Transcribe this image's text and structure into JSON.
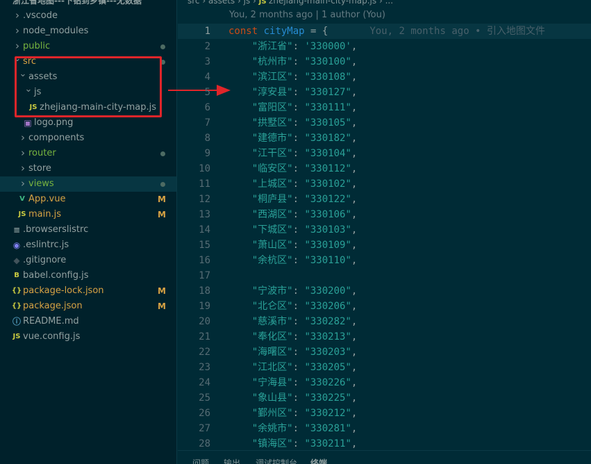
{
  "sidebar": {
    "title": "浙江省地图---下钻到乡镇---无数据",
    "items": [
      {
        "label": ".vscode",
        "type": "folder",
        "open": false,
        "depth": 0
      },
      {
        "label": "node_modules",
        "type": "folder",
        "open": false,
        "depth": 0
      },
      {
        "label": "public",
        "type": "folder",
        "open": false,
        "depth": 0,
        "color": "green",
        "dot": true
      },
      {
        "label": "src",
        "type": "folder",
        "open": true,
        "depth": 0,
        "color": "orange",
        "dot": true
      },
      {
        "label": "assets",
        "type": "folder",
        "open": true,
        "depth": 1
      },
      {
        "label": "js",
        "type": "folder",
        "open": true,
        "depth": 2
      },
      {
        "label": "zhejiang-main-city-map.js",
        "type": "file",
        "icon": "js-icon",
        "glyph": "JS",
        "depth": 3
      },
      {
        "label": "logo.png",
        "type": "file",
        "icon": "image-icon",
        "glyph": "▣",
        "depth": 2
      },
      {
        "label": "components",
        "type": "folder",
        "open": false,
        "depth": 1
      },
      {
        "label": "router",
        "type": "folder",
        "open": false,
        "depth": 1,
        "color": "green",
        "dot": true
      },
      {
        "label": "store",
        "type": "folder",
        "open": false,
        "depth": 1
      },
      {
        "label": "views",
        "type": "folder",
        "open": false,
        "depth": 1,
        "color": "green",
        "dot": true,
        "selected": true
      },
      {
        "label": "App.vue",
        "type": "file",
        "icon": "vue-icon",
        "glyph": "V",
        "depth": 1,
        "color": "orange",
        "badge": "M"
      },
      {
        "label": "main.js",
        "type": "file",
        "icon": "js-icon",
        "glyph": "JS",
        "depth": 1,
        "color": "orange",
        "badge": "M"
      },
      {
        "label": ".browserslistrc",
        "type": "file",
        "icon": "lines-icon",
        "glyph": "≡",
        "depth": 0
      },
      {
        "label": ".eslintrc.js",
        "type": "file",
        "icon": "eslint-icon",
        "glyph": "◉",
        "depth": 0
      },
      {
        "label": ".gitignore",
        "type": "file",
        "icon": "git-icon",
        "glyph": "◆",
        "depth": 0
      },
      {
        "label": "babel.config.js",
        "type": "file",
        "icon": "babel-icon",
        "glyph": "B",
        "depth": 0
      },
      {
        "label": "package-lock.json",
        "type": "file",
        "icon": "json-icon",
        "glyph": "{}",
        "depth": 0,
        "color": "orange",
        "badge": "M"
      },
      {
        "label": "package.json",
        "type": "file",
        "icon": "json-icon",
        "glyph": "{}",
        "depth": 0,
        "color": "orange",
        "badge": "M"
      },
      {
        "label": "README.md",
        "type": "file",
        "icon": "info-icon",
        "glyph": "ⓘ",
        "depth": 0
      },
      {
        "label": "vue.config.js",
        "type": "file",
        "icon": "js-icon",
        "glyph": "JS",
        "depth": 0
      }
    ]
  },
  "breadcrumb": {
    "parts": [
      "src",
      "assets",
      "js"
    ],
    "file_icon": "JS",
    "file": "zhejiang-main-city-map.js",
    "tail": "..."
  },
  "codelens": "You, 2 months ago | 1 author (You)",
  "editor": {
    "first_line": {
      "keyword": "const",
      "name": "cityMap",
      "rest": " = {",
      "blame": "You, 2 months ago • 引入地图文件"
    },
    "entries": [
      {
        "line": 2,
        "key": "浙江省",
        "value": "330000",
        "quote": "single"
      },
      {
        "line": 3,
        "key": "杭州市",
        "value": "330100"
      },
      {
        "line": 4,
        "key": "滨江区",
        "value": "330108"
      },
      {
        "line": 5,
        "key": "淳安县",
        "value": "330127"
      },
      {
        "line": 6,
        "key": "富阳区",
        "value": "330111"
      },
      {
        "line": 7,
        "key": "拱墅区",
        "value": "330105"
      },
      {
        "line": 8,
        "key": "建德市",
        "value": "330182"
      },
      {
        "line": 9,
        "key": "江干区",
        "value": "330104"
      },
      {
        "line": 10,
        "key": "临安区",
        "value": "330112"
      },
      {
        "line": 11,
        "key": "上城区",
        "value": "330102"
      },
      {
        "line": 12,
        "key": "桐庐县",
        "value": "330122"
      },
      {
        "line": 13,
        "key": "西湖区",
        "value": "330106"
      },
      {
        "line": 14,
        "key": "下城区",
        "value": "330103"
      },
      {
        "line": 15,
        "key": "萧山区",
        "value": "330109"
      },
      {
        "line": 16,
        "key": "余杭区",
        "value": "330110"
      },
      {
        "line": 17,
        "blank": true
      },
      {
        "line": 18,
        "key": "宁波市",
        "value": "330200"
      },
      {
        "line": 19,
        "key": "北仑区",
        "value": "330206"
      },
      {
        "line": 20,
        "key": "慈溪市",
        "value": "330282"
      },
      {
        "line": 21,
        "key": "奉化区",
        "value": "330213"
      },
      {
        "line": 22,
        "key": "海曙区",
        "value": "330203"
      },
      {
        "line": 23,
        "key": "江北区",
        "value": "330205"
      },
      {
        "line": 24,
        "key": "宁海县",
        "value": "330226"
      },
      {
        "line": 25,
        "key": "象山县",
        "value": "330225"
      },
      {
        "line": 26,
        "key": "鄞州区",
        "value": "330212"
      },
      {
        "line": 27,
        "key": "余姚市",
        "value": "330281"
      },
      {
        "line": 28,
        "key": "镇海区",
        "value": "330211"
      }
    ]
  },
  "panel_tabs": [
    {
      "label": "问题"
    },
    {
      "label": "输出"
    },
    {
      "label": "调试控制台"
    },
    {
      "label": "终端",
      "active": true
    }
  ],
  "colors": {
    "highlight_box": "#e0252a",
    "background": "#002b36",
    "sidebar": "#00212b"
  }
}
